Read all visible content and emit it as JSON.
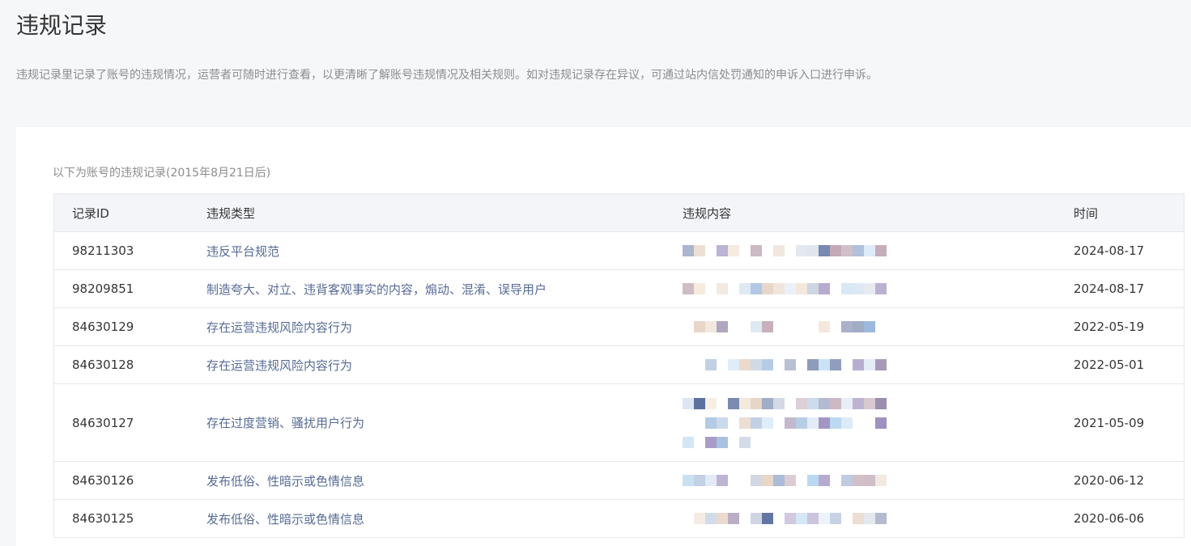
{
  "page": {
    "title": "违规记录",
    "description": "违规记录里记录了账号的违规情况，运营者可随时进行查看，以更清晰了解账号违规情况及相关规则。如对违规记录存在异议，可通过站内信处罚通知的申诉入口进行申诉。"
  },
  "table": {
    "caption": "以下为账号的违规记录(2015年8月21日后)",
    "headers": {
      "id": "记录ID",
      "type": "违规类型",
      "content": "违规内容",
      "time": "时间"
    },
    "rows": [
      {
        "id": "98211303",
        "type": "违反平台规范",
        "time": "2024-08-17",
        "content_lines": 1
      },
      {
        "id": "98209851",
        "type": "制造夸大、对立、违背客观事实的内容，煽动、混淆、误导用户",
        "time": "2024-08-17",
        "content_lines": 1
      },
      {
        "id": "84630129",
        "type": "存在运营违规风险内容行为",
        "time": "2022-05-19",
        "content_lines": 1
      },
      {
        "id": "84630128",
        "type": "存在运营违规风险内容行为",
        "time": "2022-05-01",
        "content_lines": 1
      },
      {
        "id": "84630127",
        "type": "存在过度营销、骚扰用户行为",
        "time": "2021-05-09",
        "content_lines": 3
      },
      {
        "id": "84630126",
        "type": "发布低俗、性暗示或色情信息",
        "time": "2020-06-12",
        "content_lines": 1
      },
      {
        "id": "84630125",
        "type": "发布低俗、性暗示或色情信息",
        "time": "2020-06-06",
        "content_lines": 1
      }
    ]
  },
  "colors": {
    "title": "#353535",
    "muted": "#8d8d8d",
    "link": "#576b95",
    "header_bg": "#f4f5f9",
    "border": "#e7e7eb",
    "mosaic_palette": [
      "#6f7fa6",
      "#a6b7d6",
      "#c2a9b5",
      "#8fb0d8",
      "#b9d8f0",
      "#e6d3c4",
      "#5b6f9e",
      "#9d8fbf",
      "#d8e4f2",
      "#f3e6d8",
      "#7d6a94",
      "#c9d2e0"
    ]
  }
}
